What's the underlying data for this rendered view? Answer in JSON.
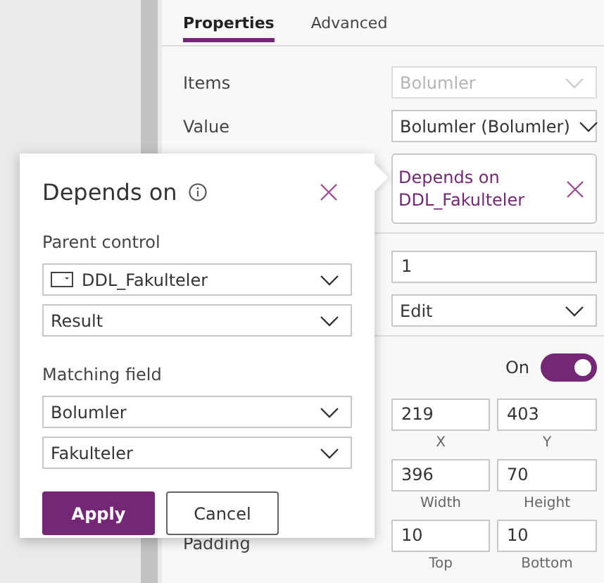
{
  "tabs": [
    {
      "label": "Properties",
      "selected": true
    },
    {
      "label": "Advanced",
      "selected": false
    }
  ],
  "properties": [
    {
      "kind": "dropdown",
      "label": "Items",
      "value": "Bolumler",
      "disabled": true
    },
    {
      "kind": "dropdown",
      "label": "Value",
      "value": "Bolumler (Bolumler)",
      "disabled": false
    },
    {
      "kind": "depends",
      "value": "Depends on DDL_Fakulteler"
    },
    {
      "kind": "text",
      "value": "1",
      "divider": true
    },
    {
      "kind": "dropdown",
      "value": "Edit",
      "disabled": false
    },
    {
      "kind": "toggle",
      "text": "On",
      "on": true,
      "divider": true
    },
    {
      "kind": "pair",
      "values": [
        "219",
        "403"
      ],
      "captions": [
        "X",
        "Y"
      ]
    },
    {
      "kind": "pair",
      "values": [
        "396",
        "70"
      ],
      "captions": [
        "Width",
        "Height"
      ]
    },
    {
      "kind": "pair",
      "label": "Padding",
      "values": [
        "10",
        "10"
      ],
      "captions": [
        "Top",
        "Bottom"
      ]
    }
  ],
  "popup": {
    "title": "Depends on",
    "sections": [
      {
        "label": "Parent control",
        "fields": [
          {
            "value": "DDL_Fakulteler",
            "icon": true
          },
          {
            "value": "Result",
            "icon": false
          }
        ]
      },
      {
        "label": "Matching field",
        "fields": [
          {
            "value": "Bolumler",
            "icon": false
          },
          {
            "value": "Fakulteler",
            "icon": false
          }
        ]
      }
    ],
    "buttons": [
      {
        "label": "Apply",
        "primary": true
      },
      {
        "label": "Cancel",
        "primary": false
      }
    ]
  }
}
